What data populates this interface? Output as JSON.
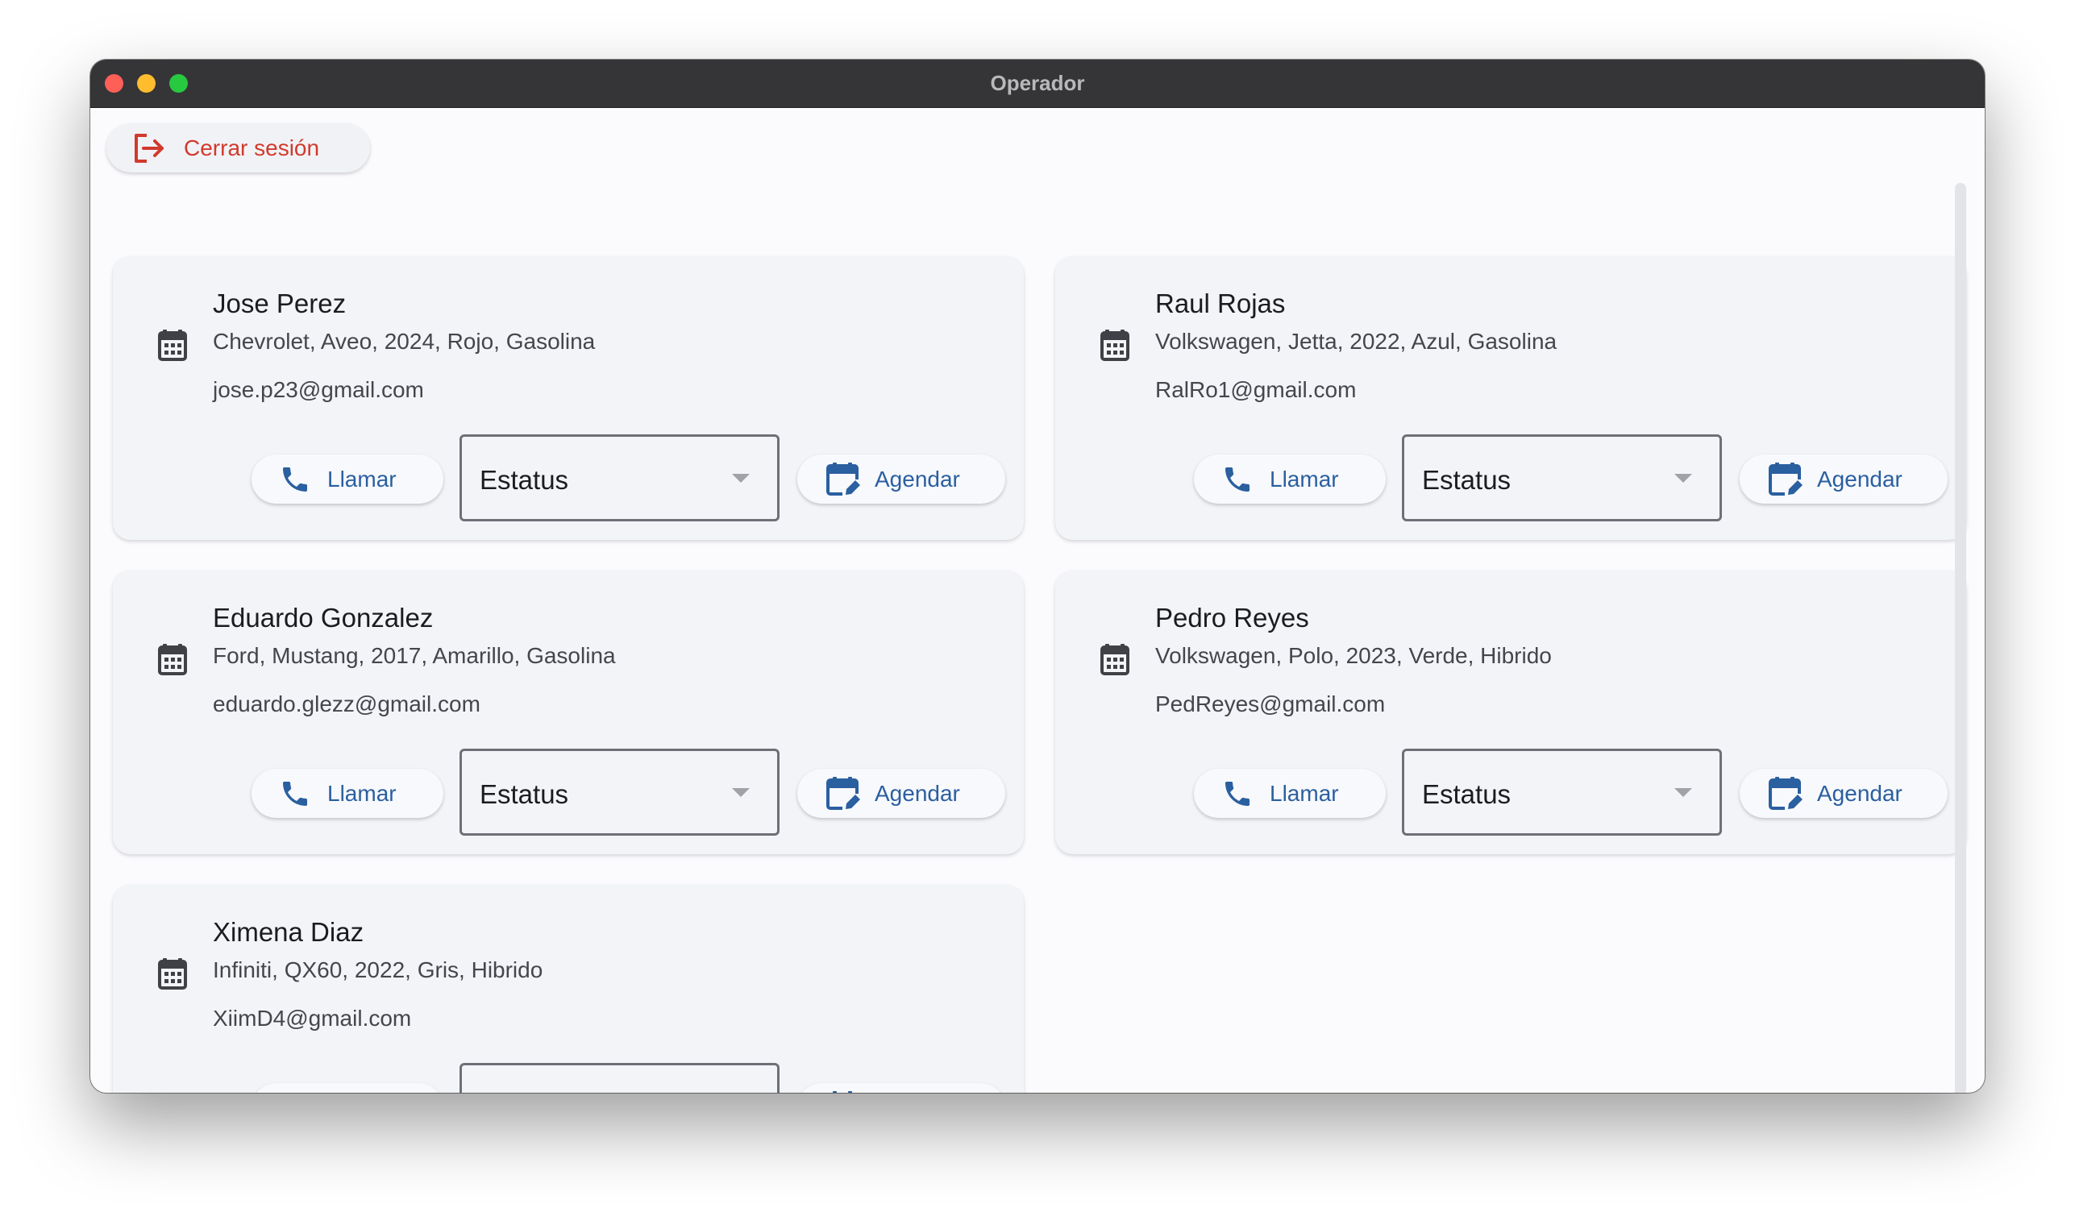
{
  "window": {
    "title": "Operador"
  },
  "header": {
    "logout_label": "Cerrar sesión"
  },
  "colors": {
    "accent": "#2a5fa0",
    "danger": "#d13a2c",
    "card_bg": "#f2f4f8",
    "titlebar": "#353538"
  },
  "card_common": {
    "call_label": "Llamar",
    "status_value": "Estatus",
    "schedule_label": "Agendar"
  },
  "icons": {
    "card": "calendar-icon",
    "call": "phone-icon",
    "schedule": "calendar-edit-icon",
    "logout": "logout-icon"
  },
  "clients": [
    {
      "name": "Jose Perez",
      "vehicle": "Chevrolet, Aveo, 2024, Rojo, Gasolina",
      "email": "jose.p23@gmail.com"
    },
    {
      "name": "Raul Rojas",
      "vehicle": "Volkswagen, Jetta, 2022, Azul, Gasolina",
      "email": "RalRo1@gmail.com"
    },
    {
      "name": "Eduardo Gonzalez",
      "vehicle": "Ford, Mustang, 2017, Amarillo, Gasolina",
      "email": "eduardo.glezz@gmail.com"
    },
    {
      "name": "Pedro Reyes",
      "vehicle": "Volkswagen, Polo, 2023, Verde, Hibrido",
      "email": "PedReyes@gmail.com"
    },
    {
      "name": "Ximena Diaz",
      "vehicle": "Infiniti, QX60, 2022, Gris, Hibrido",
      "email": "XiimD4@gmail.com"
    }
  ]
}
